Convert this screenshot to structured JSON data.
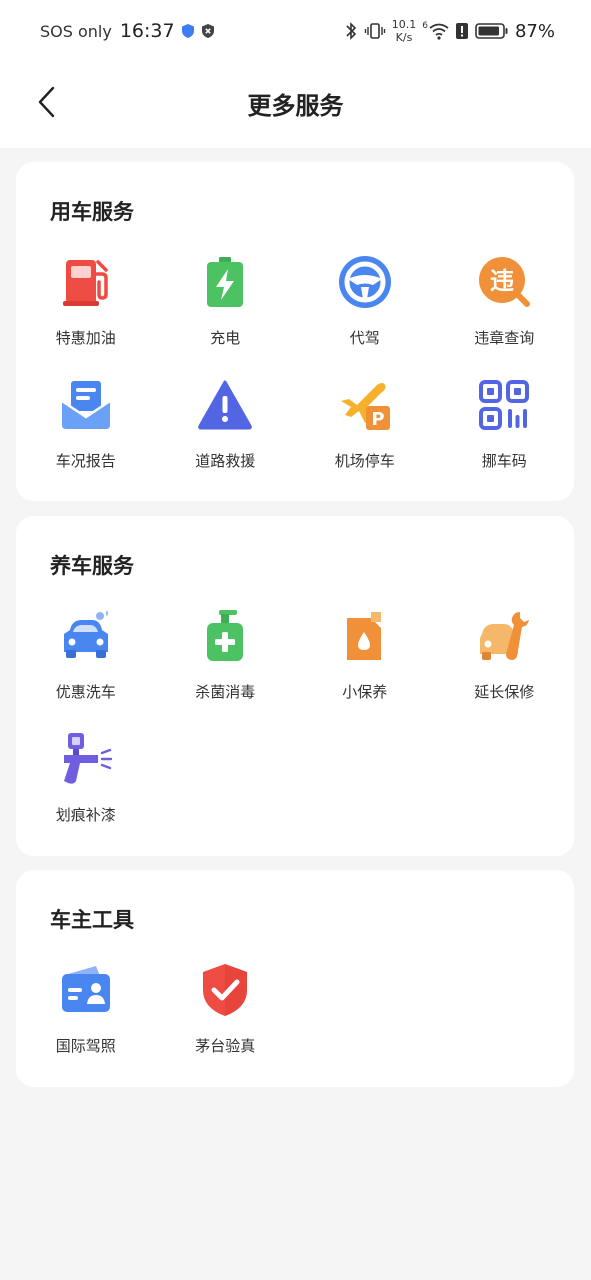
{
  "status_bar": {
    "carrier": "SOS only",
    "time": "16:37",
    "net_speed_value": "10.1",
    "net_speed_unit": "K/s",
    "signal_label": "6",
    "battery": "87%"
  },
  "header": {
    "title": "更多服务"
  },
  "sections": [
    {
      "title": "用车服务",
      "items": [
        {
          "label": "特惠加油",
          "icon": "fuel-pump-icon"
        },
        {
          "label": "充电",
          "icon": "battery-charge-icon"
        },
        {
          "label": "代驾",
          "icon": "steering-wheel-icon"
        },
        {
          "label": "违章查询",
          "icon": "violation-search-icon",
          "glyph": "违"
        },
        {
          "label": "车况报告",
          "icon": "mail-report-icon"
        },
        {
          "label": "道路救援",
          "icon": "warning-triangle-icon"
        },
        {
          "label": "机场停车",
          "icon": "airport-parking-icon",
          "glyph": "P"
        },
        {
          "label": "挪车码",
          "icon": "qr-code-icon"
        }
      ]
    },
    {
      "title": "养车服务",
      "items": [
        {
          "label": "优惠洗车",
          "icon": "car-wash-icon"
        },
        {
          "label": "杀菌消毒",
          "icon": "sanitizer-icon"
        },
        {
          "label": "小保养",
          "icon": "oil-can-icon"
        },
        {
          "label": "延长保修",
          "icon": "car-wrench-icon"
        },
        {
          "label": "划痕补漆",
          "icon": "spray-gun-icon"
        }
      ]
    },
    {
      "title": "车主工具",
      "items": [
        {
          "label": "国际驾照",
          "icon": "id-card-icon"
        },
        {
          "label": "茅台验真",
          "icon": "shield-check-icon"
        }
      ]
    }
  ],
  "colors": {
    "red": "#ee4b42",
    "green": "#4cc263",
    "blue": "#4a86f0",
    "orange": "#f0913a",
    "purple": "#6f5fe0",
    "background": "#f5f5f5"
  }
}
